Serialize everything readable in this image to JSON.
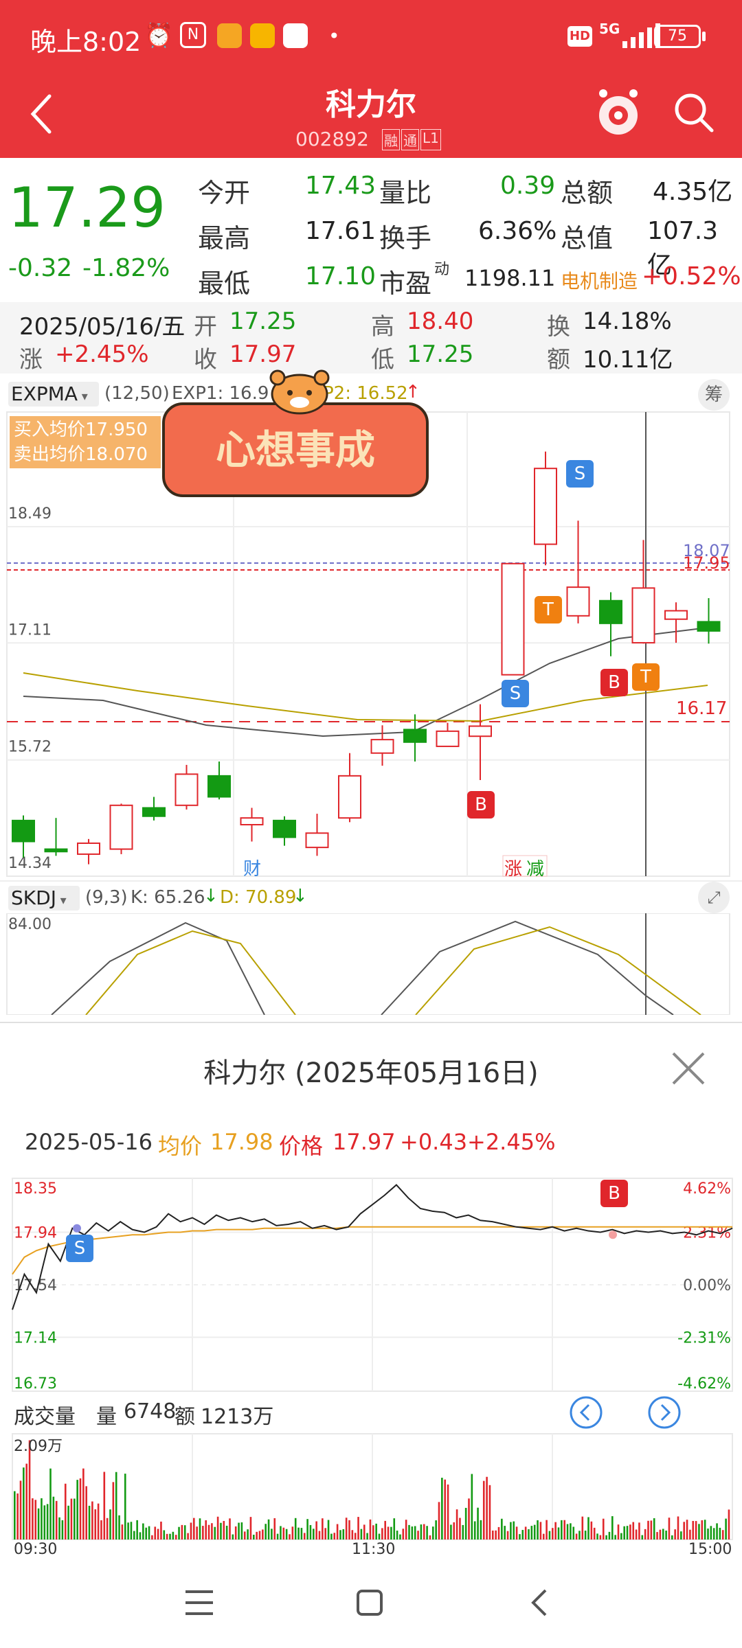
{
  "status_bar": {
    "time": "晚上8:02",
    "hd": "HD",
    "network": "5G",
    "battery": "75"
  },
  "header": {
    "title": "科力尔",
    "code": "002892",
    "tags": [
      "融",
      "通",
      "L1"
    ]
  },
  "quote": {
    "price": "17.29",
    "change": "-0.32",
    "change_pct": "-1.82%",
    "open_label": "今开",
    "open": "17.43",
    "high_label": "最高",
    "high": "17.61",
    "low_label": "最低",
    "low": "17.10",
    "vol_ratio_label": "量比",
    "vol_ratio": "0.39",
    "turnover_label": "换手",
    "turnover": "6.36%",
    "pe_label": "市盈",
    "pe_sup": "动",
    "pe": "1198.11",
    "amount_label": "总额",
    "amount": "4.35亿",
    "mktcap_label": "总值",
    "mktcap": "107.3亿",
    "sector": "电机制造",
    "sector_pct": "+0.52%"
  },
  "day_info": {
    "date": "2025/05/16/五",
    "open_label": "开",
    "open": "17.25",
    "high_label": "高",
    "high": "18.40",
    "turn_label": "换",
    "turn": "14.18%",
    "chg_label": "涨",
    "chg": "+2.45%",
    "close_label": "收",
    "close": "17.97",
    "low_label": "低",
    "low": "17.25",
    "amt_label": "额",
    "amt": "10.11亿"
  },
  "kline": {
    "indicator": "EXPMA",
    "params": "(12,50)",
    "exp1": "EXP1: 16.9",
    "exp2": "P2: 16.52",
    "chip_button": "筹",
    "buy_avg": "买入均价17.950",
    "sell_avg": "卖出均价18.070",
    "sticker_text": "心想事成",
    "y_labels": [
      "18.49",
      "17.11",
      "15.72",
      "14.34"
    ],
    "right_labels": [
      "18.07",
      "17.95",
      "16.17"
    ],
    "events": [
      "财",
      "涨",
      "减"
    ],
    "badges": {
      "s": "S",
      "b": "B",
      "t": "T"
    },
    "candles": [
      {
        "o": 14.92,
        "c": 14.67,
        "h": 14.98,
        "l": 14.48
      },
      {
        "o": 14.58,
        "c": 14.55,
        "h": 14.95,
        "l": 14.5
      },
      {
        "o": 14.52,
        "c": 14.65,
        "h": 14.7,
        "l": 14.4
      },
      {
        "o": 14.58,
        "c": 15.1,
        "h": 15.12,
        "l": 14.52
      },
      {
        "o": 15.07,
        "c": 14.97,
        "h": 15.2,
        "l": 14.92
      },
      {
        "o": 15.1,
        "c": 15.47,
        "h": 15.58,
        "l": 15.05
      },
      {
        "o": 15.45,
        "c": 15.2,
        "h": 15.62,
        "l": 15.17
      },
      {
        "o": 14.87,
        "c": 14.95,
        "h": 15.07,
        "l": 14.67
      },
      {
        "o": 14.92,
        "c": 14.72,
        "h": 14.97,
        "l": 14.62
      },
      {
        "o": 14.6,
        "c": 14.77,
        "h": 15.0,
        "l": 14.5
      },
      {
        "o": 14.95,
        "c": 15.45,
        "h": 15.72,
        "l": 14.9
      },
      {
        "o": 15.72,
        "c": 15.88,
        "h": 16.05,
        "l": 15.57
      },
      {
        "o": 16.0,
        "c": 15.85,
        "h": 16.18,
        "l": 15.62
      },
      {
        "o": 15.8,
        "c": 15.98,
        "h": 16.08,
        "l": 15.82
      },
      {
        "o": 15.92,
        "c": 16.04,
        "h": 16.3,
        "l": 15.4
      },
      {
        "o": 16.65,
        "c": 17.97,
        "h": 17.97,
        "l": 16.67
      },
      {
        "o": 18.2,
        "c": 19.1,
        "h": 19.3,
        "l": 17.95
      },
      {
        "o": 17.35,
        "c": 17.69,
        "h": 18.48,
        "l": 17.26
      },
      {
        "o": 17.53,
        "c": 17.26,
        "h": 17.63,
        "l": 16.87
      },
      {
        "o": 17.03,
        "c": 17.68,
        "h": 18.25,
        "l": 17.02
      },
      {
        "o": 17.31,
        "c": 17.41,
        "h": 17.51,
        "l": 17.03
      },
      {
        "o": 17.28,
        "c": 17.17,
        "h": 17.56,
        "l": 17.02
      }
    ]
  },
  "skdj": {
    "name": "SKDJ",
    "params": "(9,3)",
    "k": "K: 65.26",
    "d": "D: 70.89",
    "y_label": "84.00"
  },
  "intraday": {
    "title": "科力尔 (2025年05月16日)",
    "date": "2025-05-16",
    "avg_label": "均价",
    "avg": "17.98",
    "price_label": "价格",
    "price": "17.97",
    "chg": "+0.43",
    "pct": "+2.45%",
    "left_labels": [
      "18.35",
      "17.94",
      "17.54",
      "17.14",
      "16.73"
    ],
    "right_labels": [
      "4.62%",
      "2.31%",
      "0.00%",
      "-2.31%",
      "-4.62%"
    ],
    "badges": {
      "s": "S",
      "b": "B"
    },
    "prices": [
      17.35,
      17.62,
      17.48,
      17.85,
      17.72,
      17.97,
      17.92,
      18.01,
      17.95,
      18.02,
      17.96,
      17.94,
      17.98,
      18.08,
      18.02,
      18.05,
      18.0,
      18.07,
      18.03,
      18.05,
      18.02,
      18.04,
      17.99,
      18.0,
      18.02,
      17.97,
      17.99,
      17.96,
      17.98,
      18.08,
      18.15,
      18.22,
      18.3,
      18.2,
      18.12,
      18.1,
      18.09,
      18.05,
      18.07,
      18.03,
      18.02,
      18.0,
      17.98,
      17.97,
      17.96,
      17.98,
      17.95,
      17.97,
      17.95,
      17.94,
      17.96,
      17.93,
      17.95,
      17.94,
      17.95,
      17.93,
      17.94,
      17.92,
      17.95,
      17.93,
      17.97
    ],
    "avg_line": [
      17.62,
      17.75,
      17.8,
      17.83,
      17.85,
      17.87,
      17.88,
      17.89,
      17.9,
      17.91,
      17.92,
      17.92,
      17.93,
      17.94,
      17.94,
      17.95,
      17.95,
      17.96,
      17.96,
      17.96,
      17.96,
      17.97,
      17.97,
      17.97,
      17.97,
      17.97,
      17.97,
      17.97,
      17.98,
      17.98,
      17.98,
      17.98,
      17.98,
      17.98,
      17.98,
      17.98,
      17.98,
      17.98,
      17.98,
      17.98,
      17.98,
      17.98,
      17.98,
      17.98,
      17.98,
      17.98,
      17.98,
      17.98,
      17.98,
      17.98,
      17.98,
      17.98,
      17.98,
      17.98,
      17.98,
      17.98,
      17.98,
      17.98,
      17.98,
      17.98,
      17.98
    ],
    "volume_label": "成交量",
    "vol_label": "量",
    "vol": "6748",
    "amt_label": "额",
    "amt": "1213万",
    "vol_max": "2.09万",
    "time_labels": [
      "09:30",
      "11:30",
      "15:00"
    ]
  },
  "colors": {
    "brand": "#e8353a",
    "up": "#e0262b",
    "down": "#139a13",
    "avg": "#e7a020"
  }
}
